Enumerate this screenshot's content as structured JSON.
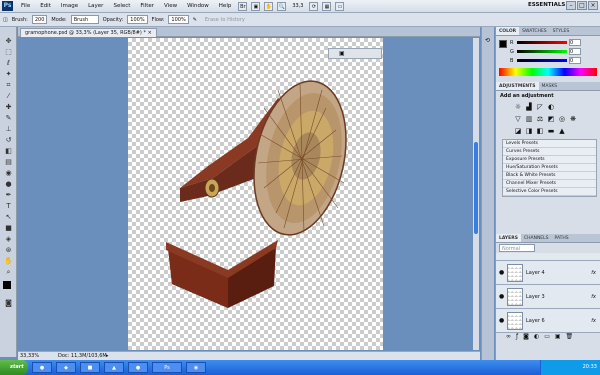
{
  "menu": {
    "logo": "Ps",
    "items": [
      "File",
      "Edit",
      "Image",
      "Layer",
      "Select",
      "Filter",
      "View",
      "Window",
      "Help"
    ],
    "zoom": "33,3",
    "workspace": "ESSENTIALS"
  },
  "options": {
    "brush_label": "Brush:",
    "brush_size": "200",
    "mode_label": "Mode:",
    "mode_value": "Brush",
    "opacity_label": "Opacity:",
    "opacity_value": "100%",
    "flow_label": "Flow:",
    "flow_value": "100%",
    "to_history_label": "Erase to History"
  },
  "document": {
    "tab_title": "gramophone.psd @ 33,3% (Layer 35, RGB/8#) *",
    "status_zoom": "33,33%",
    "status_doc": "Doc: 11,3M/103,6M"
  },
  "color_panel": {
    "tabs": [
      "COLOR",
      "SWATCHES",
      "STYLES"
    ],
    "channels": [
      {
        "name": "R",
        "value": "0"
      },
      {
        "name": "G",
        "value": "0"
      },
      {
        "name": "B",
        "value": "0"
      }
    ]
  },
  "adjustments": {
    "tabs": [
      "ADJUSTMENTS",
      "MASKS"
    ],
    "title": "Add an adjustment",
    "presets": [
      "Levels Presets",
      "Curves Presets",
      "Exposure Presets",
      "Hue/Saturation Presets",
      "Black & White Presets",
      "Channel Mixer Presets",
      "Selective Color Presets"
    ]
  },
  "layers_panel": {
    "tabs": [
      "LAYERS",
      "CHANNELS",
      "PATHS"
    ],
    "blend_mode": "Normal",
    "layers": [
      {
        "name": "Layer 4",
        "fx": "fx"
      },
      {
        "name": "Layer 3",
        "fx": "fx"
      },
      {
        "name": "Layer 6",
        "fx": "fx"
      }
    ]
  },
  "taskbar": {
    "start": "start",
    "clock": "20:33"
  },
  "colors": {
    "workspace_bg": "#6b8fbd",
    "accent": "#3c7ee0"
  }
}
